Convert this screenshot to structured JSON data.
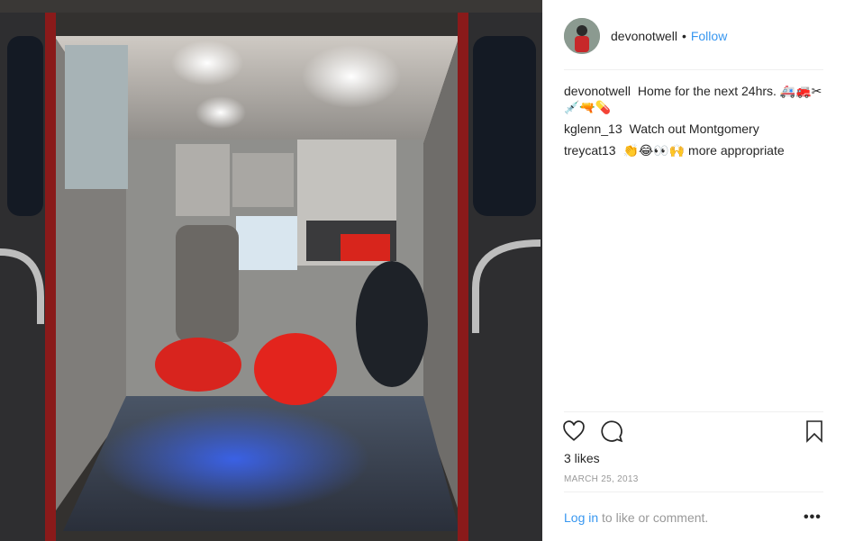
{
  "post": {
    "image_alt": "Ambulance interior with red medical bags on the floor",
    "username": "devonotwell",
    "dot": "•",
    "follow_label": "Follow",
    "caption": "Home for the next 24hrs. 🚑🚒✂ 💉🔫💊",
    "comments": [
      {
        "user": "kglenn_13",
        "text": "Watch out Montgomery"
      },
      {
        "user": "treycat13",
        "text": "👏😂👀🙌 more appropriate"
      }
    ],
    "likes": "3 likes",
    "date": "MARCH 25, 2013",
    "login_link": "Log in",
    "login_rest": "to like or comment.",
    "more_label": "•••"
  },
  "icons": {
    "like": "heart-icon",
    "comment": "comment-icon",
    "save": "bookmark-icon",
    "more": "more-icon"
  }
}
